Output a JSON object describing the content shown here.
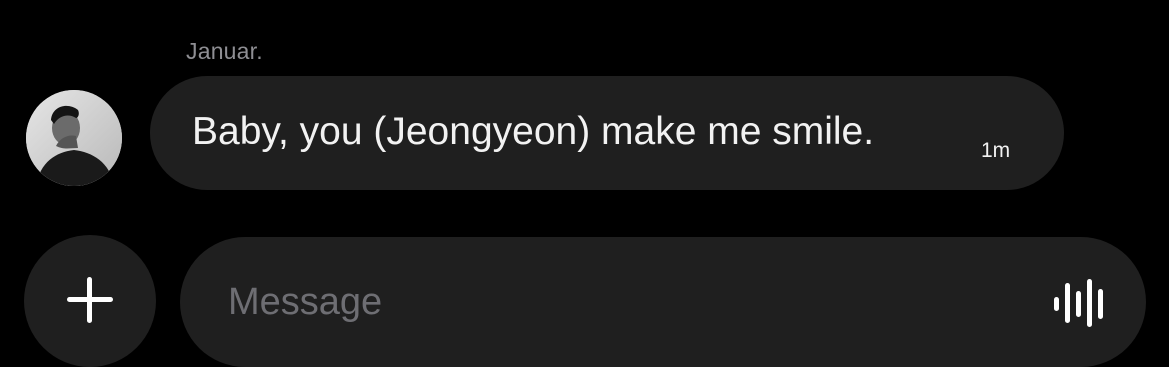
{
  "conversation": {
    "sender_name": "Januar.",
    "message": {
      "text": "Baby, you (Jeongyeon) make me smile.",
      "time": "1m"
    }
  },
  "composer": {
    "placeholder": "Message",
    "add_icon": "plus-icon",
    "voice_icon": "waveform-icon"
  },
  "colors": {
    "background": "#000000",
    "bubble": "#1f1f1f",
    "text": "#f2f2f2",
    "secondary_text": "#8e8e93",
    "placeholder": "#6e6e73"
  }
}
